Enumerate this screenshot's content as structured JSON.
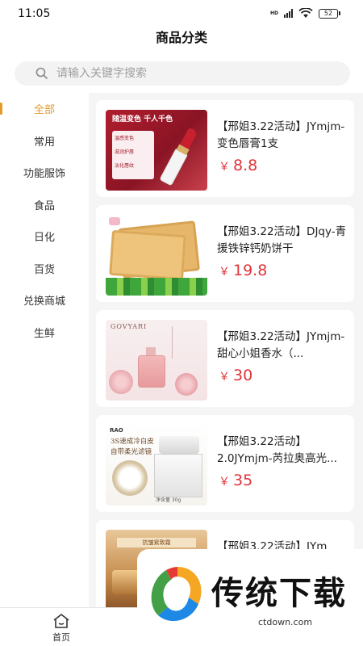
{
  "status": {
    "time": "11:05",
    "network": "HD",
    "battery": "52"
  },
  "header": {
    "title": "商品分类"
  },
  "search": {
    "placeholder": "请输入关键字搜索"
  },
  "sidebar": {
    "items": [
      {
        "label": "全部",
        "active": true
      },
      {
        "label": "常用"
      },
      {
        "label": "功能服饰"
      },
      {
        "label": "食品"
      },
      {
        "label": "日化"
      },
      {
        "label": "百货"
      },
      {
        "label": "兑换商城"
      },
      {
        "label": "生鲜"
      }
    ]
  },
  "products": [
    {
      "name": "【邢姐3.22活动】JYmjm-变色唇膏1支",
      "price": "8.8",
      "currency": "￥",
      "image_text": [
        "随温变色  千人千色",
        "温感变色",
        "滋润护唇",
        "淡化唇纹"
      ]
    },
    {
      "name": "【邢姐3.22活动】DJqy-青援铁锌钙奶饼干",
      "price": "19.8",
      "currency": "￥"
    },
    {
      "name": "【邢姐3.22活动】JYmjm-甜心小姐香水（...",
      "price": "30",
      "currency": "￥",
      "image_text": [
        "GOVYARI"
      ]
    },
    {
      "name": "【邢姐3.22活动】2.0JYmjm-芮拉奥高光...",
      "price": "35",
      "currency": "￥",
      "image_text": [
        "RAO",
        "3S速成冷白皮",
        "自带柔光滤镜",
        "净含量 30g"
      ]
    },
    {
      "name": "【邢姐3.22活动】JYm",
      "price": "",
      "currency": "",
      "image_text": [
        "抗皱紧致霜"
      ]
    }
  ],
  "bottom_nav": {
    "home_label": "首页"
  },
  "watermark": {
    "text": "传统下载",
    "url": "ctdown.com"
  },
  "colors": {
    "accent": "#e49a2c",
    "price": "#e0343a"
  }
}
